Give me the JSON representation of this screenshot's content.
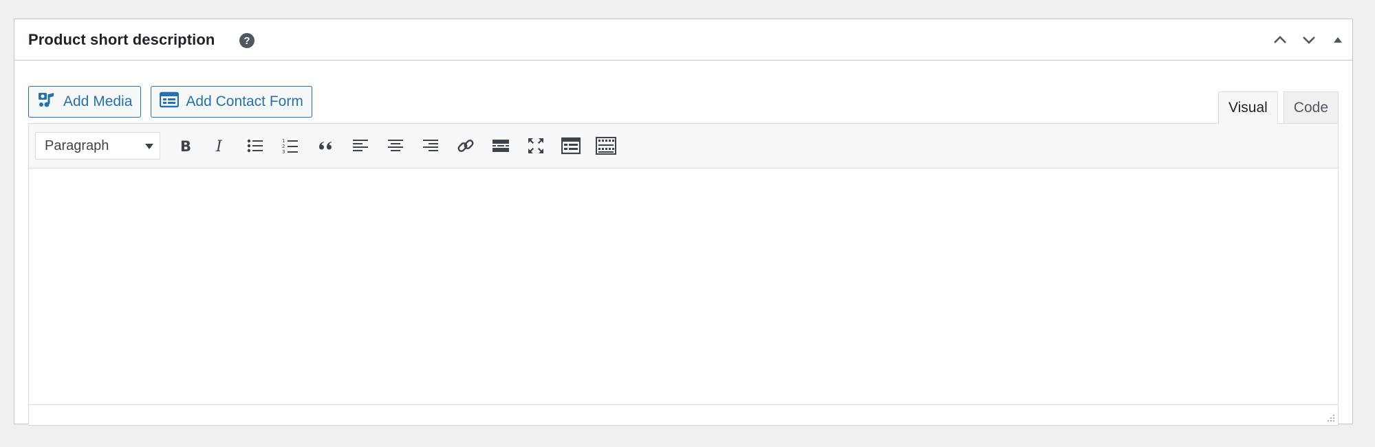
{
  "postbox": {
    "title": "Product short description",
    "help_icon": "help-icon",
    "header_actions": [
      "move-up-icon",
      "move-down-icon",
      "toggle-panel-icon"
    ]
  },
  "media_buttons": {
    "add_media": "Add Media",
    "add_contact_form": "Add Contact Form"
  },
  "tabs": {
    "visual": "Visual",
    "code": "Code",
    "active": "Visual"
  },
  "toolbar": {
    "format_select_value": "Paragraph",
    "buttons": [
      "bold-icon",
      "italic-icon",
      "bulleted-list-icon",
      "numbered-list-icon",
      "blockquote-icon",
      "align-left-icon",
      "align-center-icon",
      "align-right-icon",
      "insert-link-icon",
      "read-more-icon",
      "fullscreen-icon",
      "contact-form-icon",
      "toolbar-toggle-icon"
    ]
  },
  "colors": {
    "accent": "#2271b1",
    "icon": "#3c434a",
    "background": "#f0f0f1",
    "border": "#c3c4c7"
  }
}
